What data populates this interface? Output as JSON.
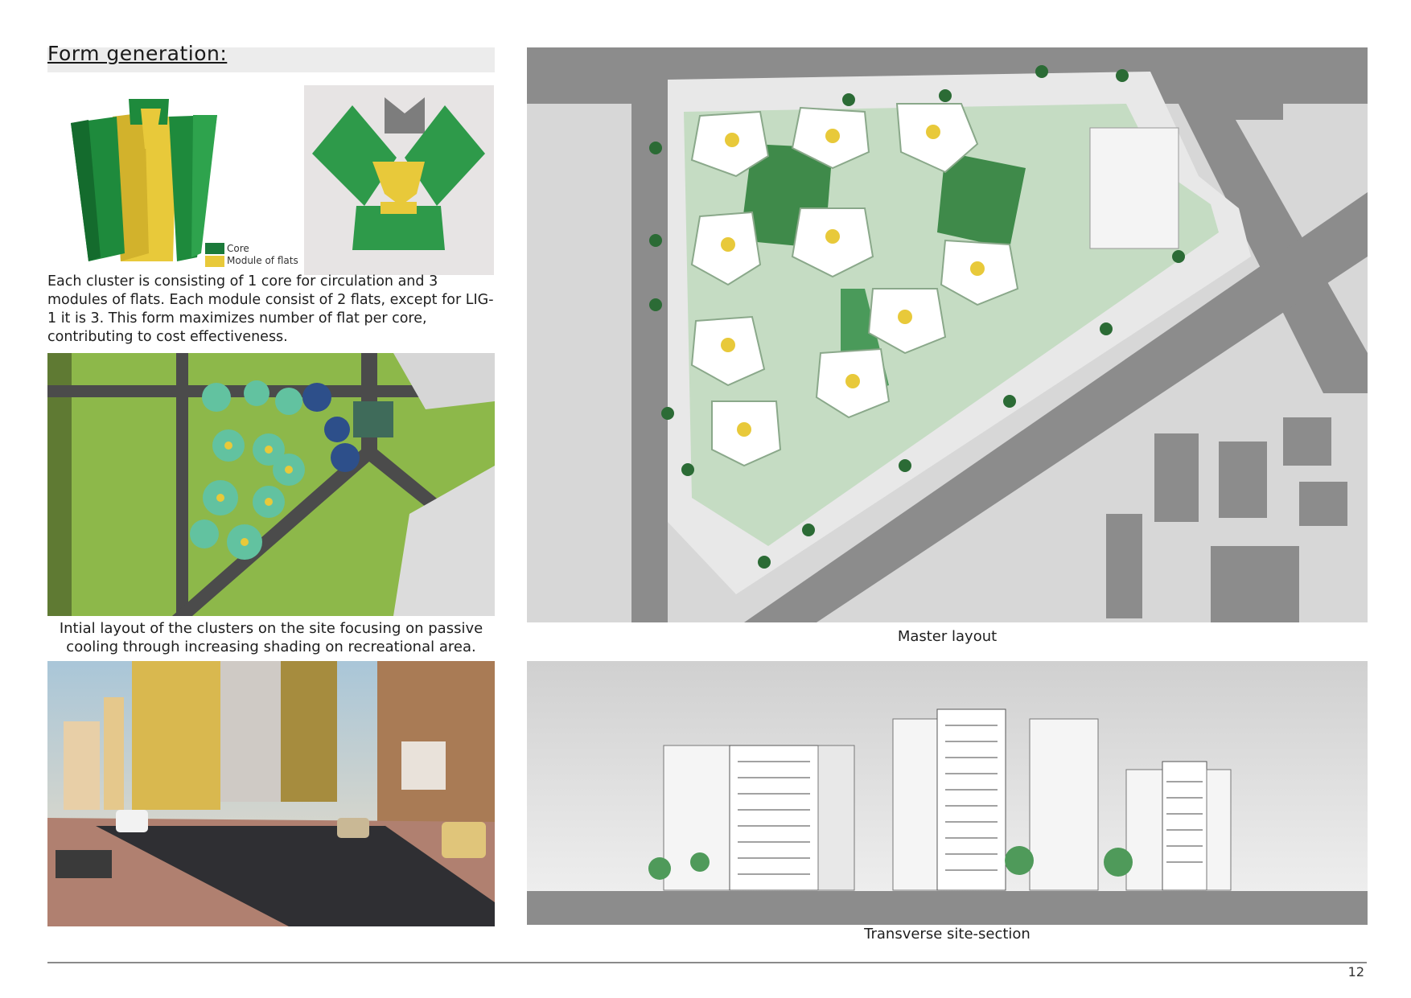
{
  "heading": "Form generation:",
  "legend": {
    "items": [
      {
        "label": "Core",
        "color": "#1b7a3a"
      },
      {
        "label": "Module of flats",
        "color": "#e8c93a"
      }
    ]
  },
  "description": "Each cluster is consisting of 1 core for circulation and 3 modules of flats. Each module consist of 2 flats, except for LIG-1 it is 3. This form maximizes number of flat per core, contributing to cost effectiveness.",
  "captions": {
    "initial_layout": "Intial layout of the clusters on the site focusing on passive cooling through increasing shading on recreational area.",
    "master_layout": "Master layout",
    "section": "Transverse site-section"
  },
  "page_number": "12"
}
